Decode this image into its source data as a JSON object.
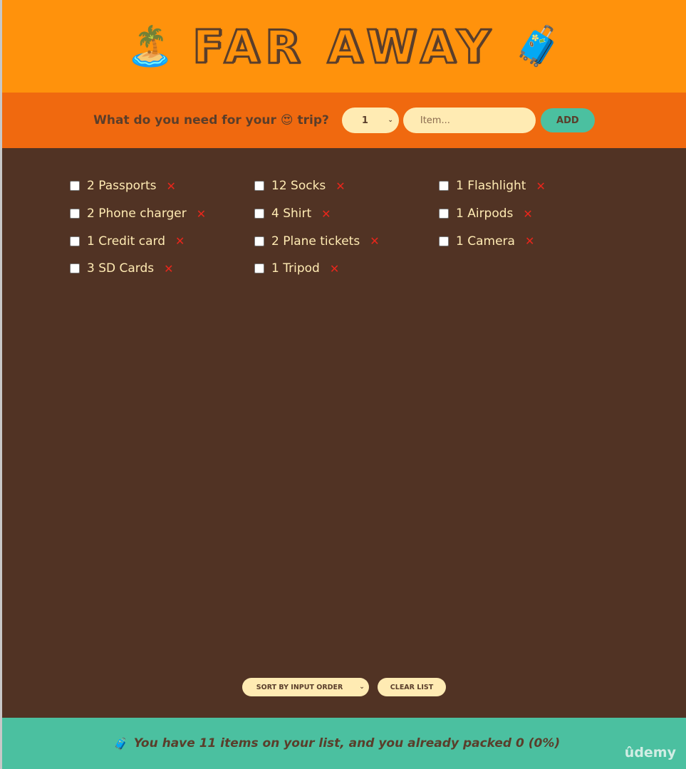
{
  "header": {
    "left_emoji": "🏝️",
    "title": "FAR AWAY",
    "right_emoji": "🧳"
  },
  "form": {
    "question": "What do you need for your 😍 trip?",
    "quantity": "1",
    "item_placeholder": "Item...",
    "add_label": "ADD"
  },
  "items": [
    {
      "label": "2 Passports"
    },
    {
      "label": "2 Phone charger"
    },
    {
      "label": "1 Credit card"
    },
    {
      "label": "3 SD Cards"
    },
    {
      "label": "12 Socks"
    },
    {
      "label": "4 Shirt"
    },
    {
      "label": "2 Plane tickets"
    },
    {
      "label": "1 Tripod"
    },
    {
      "label": "1 Flashlight"
    },
    {
      "label": "1 Airpods"
    },
    {
      "label": "1 Camera"
    }
  ],
  "delete_glyph": "✕",
  "actions": {
    "sort_label": "SORT BY INPUT ORDER",
    "clear_label": "CLEAR LIST"
  },
  "stats": {
    "emoji": "🧳",
    "text": "You have 11 items on your list, and you already packed 0 (0%)"
  },
  "watermark": "ûdemy",
  "colors": {
    "header": "#ff920c",
    "form": "#f0690f",
    "list": "#513324",
    "stats": "#4bc0a0",
    "cream": "#ffebb3",
    "brown": "#5a3e2b",
    "delete": "#e8261b"
  }
}
